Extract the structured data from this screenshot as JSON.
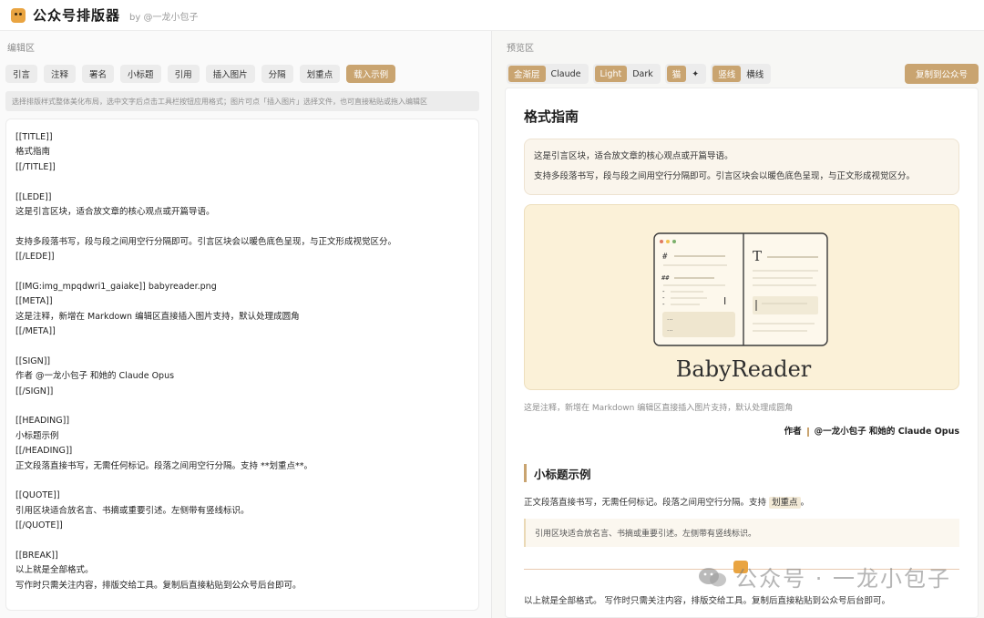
{
  "header": {
    "title": "公众号排版器",
    "by": "by @一龙小包子"
  },
  "editor_panel": {
    "label": "编辑区",
    "toolbar": [
      "引言",
      "注释",
      "署名",
      "小标题",
      "引用",
      "插入图片",
      "分隔",
      "划重点",
      "载入示例"
    ],
    "hint": "选择排版样式整体美化布局，选中文字后点击工具栏按钮应用格式；图片可点「插入图片」选择文件，也可直接粘贴或拖入编辑区",
    "lines": [
      "[[TITLE]]",
      "格式指南",
      "[[/TITLE]]",
      "",
      "[[LEDE]]",
      "这是引言区块，适合放文章的核心观点或开篇导语。",
      "",
      "支持多段落书写，段与段之间用空行分隔即可。引言区块会以暖色底色呈现，与正文形成视觉区分。",
      "[[/LEDE]]",
      "",
      "[[IMG:img_mpqdwri1_gaiake]] babyreader.png",
      "[[META]]",
      "这是注释，新增在 Markdown 编辑区直接插入图片支持，默认处理成圆角",
      "[[/META]]",
      "",
      "[[SIGN]]",
      "作者 @一龙小包子 和她的 Claude Opus",
      "[[/SIGN]]",
      "",
      "[[HEADING]]",
      "小标题示例",
      "[[/HEADING]]",
      "正文段落直接书写，无需任何标记。段落之间用空行分隔。支持 **划重点**。",
      "",
      "[[QUOTE]]",
      "引用区块适合放名言、书摘或重要引述。左侧带有竖线标识。",
      "[[/QUOTE]]",
      "",
      "[[BREAK]]",
      "以上就是全部格式。",
      "写作时只需关注内容，排版交给工具。复制后直接粘贴到公众号后台即可。"
    ]
  },
  "preview_panel": {
    "label": "预览区",
    "theme_options": [
      "金渐层",
      "Claude"
    ],
    "mode_options": [
      "Light",
      "Dark"
    ],
    "icon_options": [
      "猫",
      "✦"
    ],
    "line_options": [
      "竖线",
      "横线"
    ],
    "copy_button": "复制到公众号",
    "title": "格式指南",
    "lede": [
      "这是引言区块，适合放文章的核心观点或开篇导语。",
      "支持多段落书写，段与段之间用空行分隔即可。引言区块会以暖色底色呈现，与正文形成视觉区分。"
    ],
    "image_caption": "BabyReader",
    "meta": "这是注释，新增在 Markdown 编辑区直接插入图片支持，默认处理成圆角",
    "sign_prefix": "作者",
    "sign_name": "@一龙小包子 和她的 Claude Opus",
    "heading": "小标题示例",
    "body_before": "正文段落直接书写，无需任何标记。段落之间用空行分隔。支持 ",
    "body_mark": "划重点",
    "body_after": "。",
    "quote": "引用区块适合放名言、书摘或重要引述。左侧带有竖线标识。",
    "ending": "以上就是全部格式。 写作时只需关注内容，排版交给工具。复制后直接粘贴到公众号后台即可。"
  },
  "watermark": "公众号 · 一龙小包子",
  "colors": {
    "accent": "#c9a470",
    "lede_bg": "#faf5ec",
    "image_bg": "#fbf1d8"
  }
}
